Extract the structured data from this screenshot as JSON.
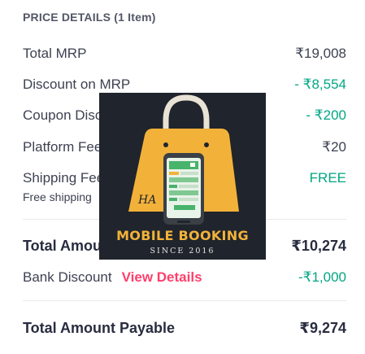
{
  "price_details": {
    "header": "PRICE DETAILS (1 Item)",
    "rows": [
      {
        "label": "Total MRP",
        "value": "₹19,008"
      },
      {
        "label": "Discount on MRP",
        "value": "- ₹8,554"
      },
      {
        "label": "Coupon Discount",
        "value": "- ₹200"
      },
      {
        "label": "Platform Fee",
        "value": "₹20"
      },
      {
        "label": "Shipping Fee",
        "value": "FREE",
        "sub": "Free shipping"
      }
    ],
    "total_amount": {
      "label": "Total Amount",
      "value": "₹10,274"
    },
    "bank_discount": {
      "label": "Bank Discount",
      "link": "View Details",
      "value": "-₹1,000"
    },
    "payable": {
      "label": "Total Amount Payable",
      "value": "₹9,274"
    }
  },
  "overlay_logo": {
    "title": "MOBILE BOOKING",
    "subtitle": "SINCE 2016",
    "monogram": "HA",
    "colors": {
      "background": "#20242c",
      "bag": "#f2b23a",
      "title": "#f2b23a"
    }
  },
  "colors": {
    "green": "#03a685",
    "pink": "#ff3f6c",
    "text": "#3e4152"
  }
}
